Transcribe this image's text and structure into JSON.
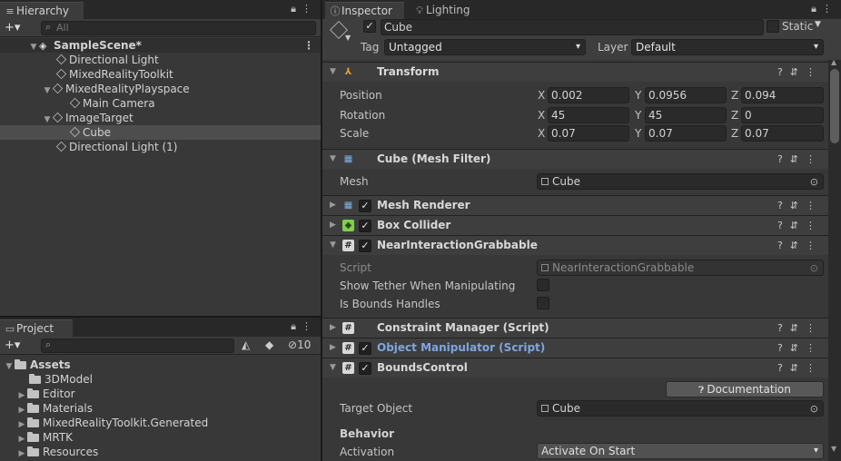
{
  "hierarchy": {
    "tab_label": "Hierarchy",
    "search_placeholder": "All",
    "add_label": "+▾",
    "scene_name": "SampleScene*",
    "items": [
      {
        "label": "Directional Light"
      },
      {
        "label": "MixedRealityToolkit"
      },
      {
        "label": "MixedRealityPlayspace"
      },
      {
        "label": "Main Camera"
      },
      {
        "label": "ImageTarget"
      },
      {
        "label": "Cube"
      },
      {
        "label": "Directional Light (1)"
      }
    ]
  },
  "project": {
    "tab_label": "Project",
    "add_label": "+▾",
    "hidden_count": "10",
    "assets_label": "Assets",
    "folders": [
      {
        "label": "3DModel"
      },
      {
        "label": "Editor"
      },
      {
        "label": "Materials"
      },
      {
        "label": "MixedRealityToolkit.Generated"
      },
      {
        "label": "MRTK"
      },
      {
        "label": "Resources"
      }
    ]
  },
  "inspector": {
    "tab_label": "Inspector",
    "lighting_tab_label": "Lighting",
    "object_name": "Cube",
    "static_label": "Static",
    "tag_label": "Tag",
    "tag_value": "Untagged",
    "layer_label": "Layer",
    "layer_value": "Default",
    "transform": {
      "title": "Transform",
      "position_label": "Position",
      "rotation_label": "Rotation",
      "scale_label": "Scale",
      "x_label": "X",
      "y_label": "Y",
      "z_label": "Z",
      "position": {
        "x": "0.002",
        "y": "0.0956",
        "z": "0.094"
      },
      "rotation": {
        "x": "45",
        "y": "45",
        "z": "0"
      },
      "scale": {
        "x": "0.07",
        "y": "0.07",
        "z": "0.07"
      }
    },
    "mesh_filter": {
      "title": "Cube (Mesh Filter)",
      "mesh_label": "Mesh",
      "mesh_value": "Cube"
    },
    "mesh_renderer": {
      "title": "Mesh Renderer"
    },
    "box_collider": {
      "title": "Box Collider"
    },
    "grabbable": {
      "title": "NearInteractionGrabbable",
      "script_label": "Script",
      "script_value": "NearInteractionGrabbable",
      "tether_label": "Show Tether When Manipulating",
      "bounds_label": "Is Bounds Handles"
    },
    "constraint_manager": {
      "title": "Constraint Manager (Script)"
    },
    "object_manipulator": {
      "title": "Object Manipulator (Script)"
    },
    "bounds_control": {
      "title": "BoundsControl",
      "doc_button": "Documentation",
      "target_label": "Target Object",
      "target_value": "Cube",
      "behavior_label": "Behavior",
      "activation_label": "Activation",
      "activation_value": "Activate On Start"
    },
    "header_icons": "?⇵⋮"
  },
  "colors": {
    "panel_bg": "#383838",
    "selected_row": "#4d4d4d",
    "link_blue": "#7ea6e0"
  }
}
